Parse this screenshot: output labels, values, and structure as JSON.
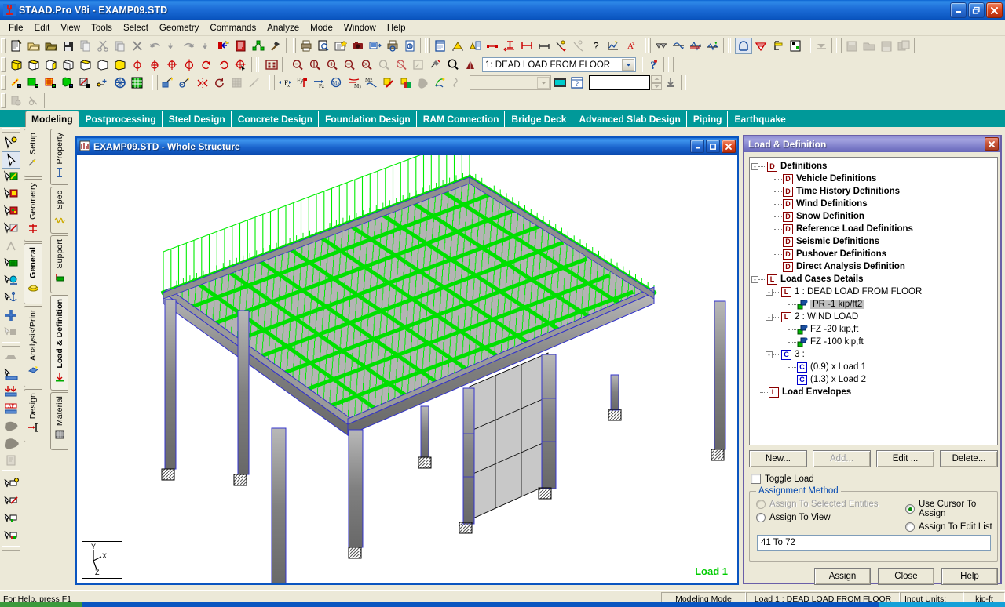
{
  "window": {
    "title": "STAAD.Pro V8i - EXAMP09.STD",
    "minimize": "_",
    "maximize": "□",
    "close": "✕"
  },
  "menu": [
    {
      "label": "File"
    },
    {
      "label": "Edit"
    },
    {
      "label": "View"
    },
    {
      "label": "Tools"
    },
    {
      "label": "Select"
    },
    {
      "label": "Geometry"
    },
    {
      "label": "Commands"
    },
    {
      "label": "Analyze"
    },
    {
      "label": "Mode"
    },
    {
      "label": "Window"
    },
    {
      "label": "Help"
    }
  ],
  "toolbar": {
    "load_case_combo": "1: DEAD LOAD FROM FLOOR",
    "load_case_arrow": "▼",
    "secondary_combo": "",
    "value_box": "",
    "help_icon": "help-question-icon"
  },
  "page_tabs": [
    {
      "label": "Modeling",
      "active": true
    },
    {
      "label": "Postprocessing",
      "active": false
    },
    {
      "label": "Steel Design",
      "active": false
    },
    {
      "label": "Concrete Design",
      "active": false
    },
    {
      "label": "Foundation Design",
      "active": false
    },
    {
      "label": "RAM Connection",
      "active": false
    },
    {
      "label": "Bridge Deck",
      "active": false
    },
    {
      "label": "Advanced Slab Design",
      "active": false
    },
    {
      "label": "Piping",
      "active": false
    },
    {
      "label": "Earthquake",
      "active": false
    }
  ],
  "vertical_tabs_outer": [
    {
      "label": "Setup",
      "active": false
    },
    {
      "label": "Geometry",
      "active": false
    },
    {
      "label": "General",
      "active": true
    },
    {
      "label": "Analysis/Print",
      "active": false
    },
    {
      "label": "Design",
      "active": false
    }
  ],
  "vertical_tabs_inner": [
    {
      "label": "Property",
      "active": false
    },
    {
      "label": "Spec",
      "active": false
    },
    {
      "label": "Support",
      "active": false
    },
    {
      "label": "Load & Definition",
      "active": true
    },
    {
      "label": "Material",
      "active": false
    }
  ],
  "mdi": {
    "title": "EXAMP09.STD - Whole Structure",
    "minimize": "_",
    "maximize": "□",
    "close": "✕",
    "load_label": "Load 1",
    "axis": {
      "x": "X",
      "y": "Y",
      "z": "Z"
    }
  },
  "dialog": {
    "title": "Load & Definition",
    "close": "✕",
    "tree": [
      {
        "level": 0,
        "expander": "-",
        "icon": "D",
        "icon_color": "red",
        "label": "Definitions",
        "bold": true,
        "selected": false
      },
      {
        "level": 1,
        "expander": "",
        "icon": "D",
        "icon_color": "red",
        "label": "Vehicle Definitions",
        "bold": true,
        "selected": false
      },
      {
        "level": 1,
        "expander": "",
        "icon": "D",
        "icon_color": "red",
        "label": "Time History Definitions",
        "bold": true,
        "selected": false
      },
      {
        "level": 1,
        "expander": "",
        "icon": "D",
        "icon_color": "red",
        "label": "Wind Definitions",
        "bold": true,
        "selected": false
      },
      {
        "level": 1,
        "expander": "",
        "icon": "D",
        "icon_color": "red",
        "label": "Snow Definition",
        "bold": true,
        "selected": false
      },
      {
        "level": 1,
        "expander": "",
        "icon": "D",
        "icon_color": "red",
        "label": "Reference Load Definitions",
        "bold": true,
        "selected": false
      },
      {
        "level": 1,
        "expander": "",
        "icon": "D",
        "icon_color": "red",
        "label": "Seismic Definitions",
        "bold": true,
        "selected": false
      },
      {
        "level": 1,
        "expander": "",
        "icon": "D",
        "icon_color": "red",
        "label": "Pushover Definitions",
        "bold": true,
        "selected": false
      },
      {
        "level": 1,
        "expander": "",
        "icon": "D",
        "icon_color": "red",
        "label": "Direct Analysis Definition",
        "bold": true,
        "selected": false
      },
      {
        "level": 0,
        "expander": "-",
        "icon": "L",
        "icon_color": "red",
        "label": "Load Cases Details",
        "bold": true,
        "selected": false
      },
      {
        "level": 1,
        "expander": "-",
        "icon": "L",
        "icon_color": "red",
        "label": "1 : DEAD LOAD FROM FLOOR",
        "bold": false,
        "selected": false
      },
      {
        "level": 2,
        "expander": "",
        "icon": "cube",
        "icon_color": "green",
        "label": "PR -1  kip/ft2",
        "bold": false,
        "selected": true
      },
      {
        "level": 1,
        "expander": "-",
        "icon": "L",
        "icon_color": "red",
        "label": "2 : WIND LOAD",
        "bold": false,
        "selected": false
      },
      {
        "level": 2,
        "expander": "",
        "icon": "cube",
        "icon_color": "green",
        "label": "FZ -20 kip,ft",
        "bold": false,
        "selected": false
      },
      {
        "level": 2,
        "expander": "",
        "icon": "cube",
        "icon_color": "green",
        "label": "FZ -100 kip,ft",
        "bold": false,
        "selected": false
      },
      {
        "level": 1,
        "expander": "-",
        "icon": "C",
        "icon_color": "blue",
        "label": "3 :",
        "bold": false,
        "selected": false
      },
      {
        "level": 2,
        "expander": "",
        "icon": "C",
        "icon_color": "blue",
        "label": "(0.9) x Load 1",
        "bold": false,
        "selected": false
      },
      {
        "level": 2,
        "expander": "",
        "icon": "C",
        "icon_color": "blue",
        "label": "(1.3) x Load 2",
        "bold": false,
        "selected": false
      },
      {
        "level": 0,
        "expander": "",
        "icon": "L",
        "icon_color": "red",
        "label": "Load Envelopes",
        "bold": true,
        "selected": false
      }
    ],
    "buttons_row1": [
      {
        "label": "New...",
        "enabled": true
      },
      {
        "label": "Add...",
        "enabled": false
      },
      {
        "label": "Edit ...",
        "enabled": true
      },
      {
        "label": "Delete...",
        "enabled": true
      }
    ],
    "toggle_load": {
      "label": "Toggle Load",
      "checked": false
    },
    "assignment_method": {
      "title": "Assignment Method",
      "options": [
        {
          "label": "Assign To Selected Entities",
          "selected": false,
          "enabled": false
        },
        {
          "label": "Use Cursor To Assign",
          "selected": true,
          "enabled": true
        },
        {
          "label": "Assign To View",
          "selected": false,
          "enabled": true
        },
        {
          "label": "Assign To Edit List",
          "selected": false,
          "enabled": true
        }
      ],
      "edit_list_value": "41 To 72"
    },
    "buttons_row2": [
      {
        "label": "Assign",
        "enabled": true
      },
      {
        "label": "Close",
        "enabled": true
      },
      {
        "label": "Help",
        "enabled": true
      }
    ]
  },
  "statusbar": {
    "hint": "For Help, press F1",
    "mode": "Modeling Mode",
    "load": "Load 1 : DEAD LOAD FROM FLOOR",
    "units_label": "Input Units:",
    "units_value": "kip-ft"
  },
  "colors": {
    "titlebar_blue": "#1e6fd9",
    "chrome": "#ece9d8",
    "teal_tabs": "#009999",
    "dialog_purple": "#7b7bc8",
    "load_green": "#00cc00",
    "member_blue": "#3333cc",
    "member_gray": "#808080"
  }
}
